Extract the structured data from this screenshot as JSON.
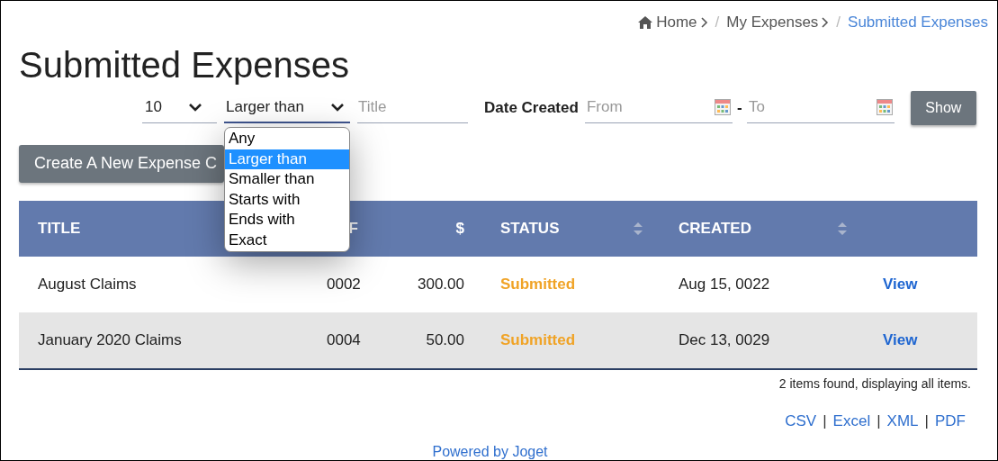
{
  "breadcrumb": [
    {
      "label": "Home",
      "kind": "home",
      "current": false
    },
    {
      "label": "My Expenses",
      "kind": "link",
      "current": false
    },
    {
      "label": "Submitted Expenses",
      "kind": "link",
      "current": true
    }
  ],
  "breadcrumb_separator": "/",
  "page_title": "Submitted Expenses",
  "filters": {
    "page_size": "10",
    "match_select": {
      "value": "Larger than",
      "expanded": true,
      "options": [
        {
          "label": "Any",
          "selected": false
        },
        {
          "label": "Larger than",
          "selected": true
        },
        {
          "label": "Smaller than",
          "selected": false
        },
        {
          "label": "Starts with",
          "selected": false
        },
        {
          "label": "Ends with",
          "selected": false
        },
        {
          "label": "Exact",
          "selected": false
        }
      ]
    },
    "title_placeholder": "Title",
    "date_label": "Date Created",
    "from_placeholder": "From",
    "separator": "-",
    "to_placeholder": "To",
    "show_button": "Show"
  },
  "create_button": "Create A New Expense C",
  "table": {
    "columns": [
      {
        "label": "TITLE",
        "sortable": false
      },
      {
        "label": "F",
        "sortable": false
      },
      {
        "label": "$",
        "sortable": false
      },
      {
        "label": "STATUS",
        "sortable": true
      },
      {
        "label": "CREATED",
        "sortable": true
      }
    ],
    "rows": [
      {
        "title": "August Claims",
        "ref": "0002",
        "amount": "300.00",
        "status": "Submitted",
        "created": "Aug 15, 0022",
        "action": "View"
      },
      {
        "title": "January 2020 Claims",
        "ref": "0004",
        "amount": "50.00",
        "status": "Submitted",
        "created": "Dec 13, 0029",
        "action": "View"
      }
    ]
  },
  "summary": "2 items found, displaying all items.",
  "exports": [
    "CSV",
    "Excel",
    "XML",
    "PDF"
  ],
  "export_separator": "|",
  "powered_by": "Powered by Joget"
}
